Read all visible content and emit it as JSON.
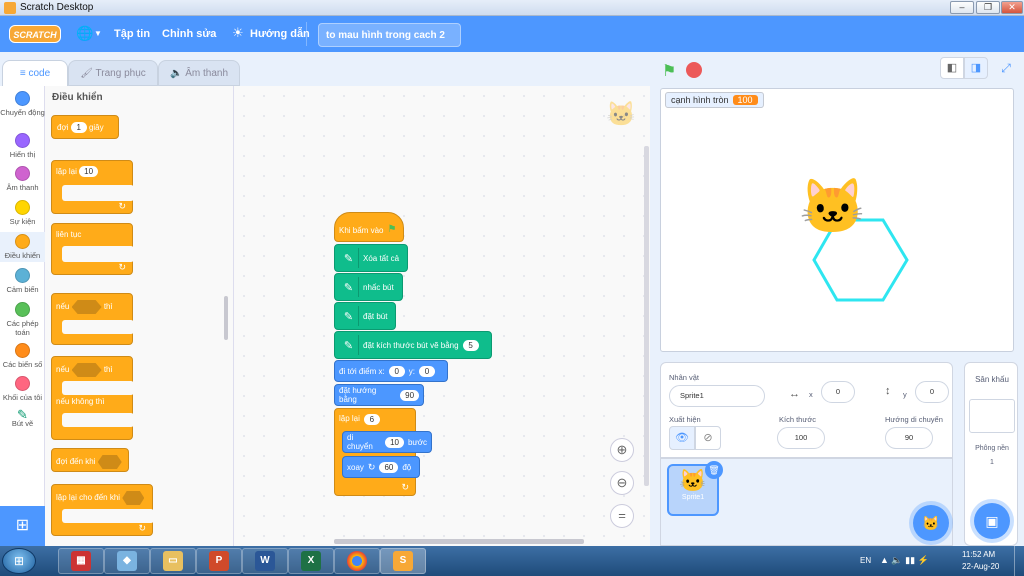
{
  "window": {
    "title": "Scratch Desktop"
  },
  "menubar": {
    "logo": "SCRATCH",
    "file": "Tập tin",
    "edit": "Chỉnh sửa",
    "tutorials": "Hướng dẫn",
    "project_name": "to mau hình trong cach 2"
  },
  "tabs": [
    {
      "label": "code"
    },
    {
      "label": "Trang phục"
    },
    {
      "label": "Âm thanh"
    }
  ],
  "categories": [
    {
      "label": "Chuyển động",
      "color": "#4c97ff"
    },
    {
      "label": "Hiển thị",
      "color": "#9966ff"
    },
    {
      "label": "Âm thanh",
      "color": "#cf63cf"
    },
    {
      "label": "Sự kiện",
      "color": "#ffd500"
    },
    {
      "label": "Điều khiển",
      "color": "#ffab19"
    },
    {
      "label": "Cảm biến",
      "color": "#5cb1d6"
    },
    {
      "label": "Các phép toán",
      "color": "#59c059"
    },
    {
      "label": "Các biến số",
      "color": "#ff8c1a"
    },
    {
      "label": "Khối của tôi",
      "color": "#ff6680"
    },
    {
      "label": "Bút vẽ",
      "color": "#0fbd8c"
    }
  ],
  "palette": {
    "title": "Điều khiển",
    "wait": {
      "label": "đợi",
      "value": "1",
      "unit": "giây"
    },
    "repeat": {
      "label": "lặp lại",
      "value": "10"
    },
    "forever": {
      "label": "liên tục"
    },
    "if": {
      "label": "nếu",
      "then": "thì"
    },
    "ifelse": {
      "label": "nếu",
      "then": "thì",
      "else": "nếu không thì"
    },
    "wait_until": {
      "label": "đợi đến khi"
    },
    "repeat_until": {
      "label": "lặp lại cho đến khi"
    }
  },
  "script": {
    "hat": "Khi bấm vào",
    "erase": "Xóa tất cả",
    "pen_up": "nhấc bút",
    "pen_down": "đặt bút",
    "set_size": {
      "label": "đặt kích thước bút vẽ bằng",
      "value": "5"
    },
    "goto": {
      "label": "đi tới điểm x:",
      "x": "0",
      "ylabel": "y:",
      "y": "0"
    },
    "point": {
      "label": "đặt hướng bằng",
      "value": "90"
    },
    "repeat": {
      "label": "lặp lại",
      "value": "6"
    },
    "move": {
      "label": "di chuyển",
      "value": "10",
      "unit": "bước"
    },
    "turn": {
      "label": "xoay",
      "value": "60",
      "unit": "độ"
    }
  },
  "stage": {
    "monitor_label": "cạnh hình tròn",
    "monitor_value": "100"
  },
  "sprite_info": {
    "sprite_label": "Nhân vật",
    "sprite_name": "Sprite1",
    "x_label": "x",
    "x": "0",
    "y_label": "y",
    "y": "0",
    "show_label": "Xuất hiện",
    "size_label": "Kích thước",
    "size": "100",
    "direction_label": "Hướng di chuyển",
    "direction": "90"
  },
  "sprite_list": [
    {
      "name": "Sprite1"
    }
  ],
  "stage_panel": {
    "title": "Sân khấu",
    "backdrops_label": "Phông nền",
    "backdrops": "1"
  },
  "taskbar": {
    "lang": "EN",
    "time": "11:52 AM",
    "date": "22-Aug-20"
  },
  "colors": {
    "accent": "#4d97ff",
    "control": "#ffab19",
    "pen": "#0fbd8c",
    "motion": "#4c97ff",
    "hexagon": "#2ee6f0"
  }
}
